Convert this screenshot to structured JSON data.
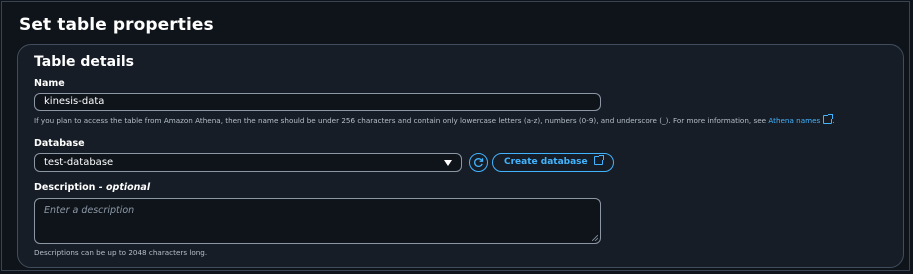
{
  "header": {
    "title": "Set table properties"
  },
  "table_details": {
    "title": "Table details",
    "name": {
      "label": "Name",
      "value": "kinesis-data",
      "hint": "If you plan to access the table from Amazon Athena, then the name should be under 256 characters and contain only lowercase letters (a-z), numbers (0-9), and underscore (_). For more information, see ",
      "link_text": "Athena names"
    },
    "database": {
      "label": "Database",
      "selected": "test-database",
      "create_label": "Create database"
    },
    "description": {
      "label": "Description",
      "label_suffix": " - optional",
      "placeholder": "Enter a description",
      "hint": "Descriptions can be up to 2048 characters long."
    }
  },
  "icons": {
    "refresh": "refresh-icon",
    "external": "external-link-icon",
    "dropdown": "caret-down-icon"
  },
  "colors": {
    "accent": "#42b4ff",
    "background": "#0f141a",
    "panel": "#161d26"
  }
}
